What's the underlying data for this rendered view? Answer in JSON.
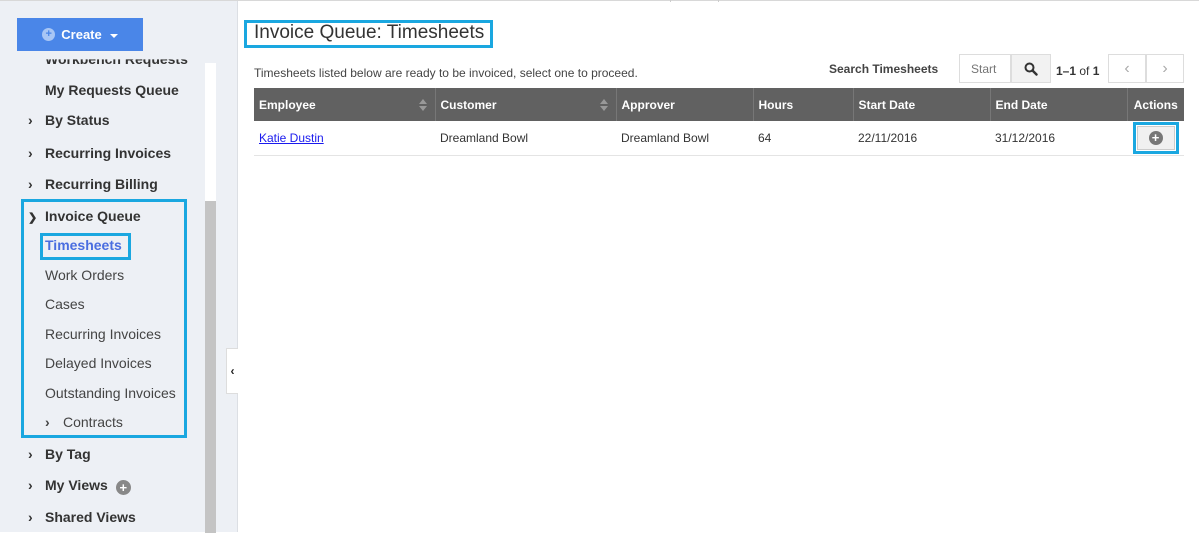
{
  "sidebar": {
    "create_label": "Create",
    "cut_item": "Workbench Requests",
    "items": [
      {
        "label": "My Requests Queue",
        "chevron": ""
      },
      {
        "label": "By Status",
        "chevron": "›"
      },
      {
        "label": "Recurring Invoices",
        "chevron": "›"
      },
      {
        "label": "Recurring Billing",
        "chevron": "›"
      },
      {
        "label": "Invoice Queue",
        "chevron": "⌄"
      }
    ],
    "invoice_queue_children": [
      {
        "label": "Timesheets",
        "active": true
      },
      {
        "label": "Work Orders"
      },
      {
        "label": "Cases"
      },
      {
        "label": "Recurring Invoices"
      },
      {
        "label": "Delayed Invoices"
      },
      {
        "label": "Outstanding Invoices"
      },
      {
        "label": "Contracts",
        "chevron": "›"
      }
    ],
    "bottom_items": [
      {
        "label": "By Tag",
        "chevron": "›"
      },
      {
        "label": "My Views",
        "chevron": "›"
      },
      {
        "label": "Shared Views",
        "chevron": "›"
      }
    ],
    "collapse_glyph": "‹"
  },
  "main": {
    "title": "Invoice Queue: Timesheets",
    "description": "Timesheets listed below are ready to be invoiced, select one to proceed.",
    "search": {
      "label": "Search Timesheets",
      "placeholder": "Start"
    },
    "pager": {
      "range": "1–1",
      "of_label": "of",
      "total": "1",
      "prev": "‹",
      "next": "›"
    },
    "table": {
      "columns": [
        "Employee",
        "Customer",
        "Approver",
        "Hours",
        "Start Date",
        "End Date",
        "Actions"
      ],
      "rows": [
        {
          "employee": "Katie Dustin",
          "customer": "Dreamland Bowl",
          "approver": "Dreamland Bowl",
          "hours": "64",
          "start_date": "22/11/2016",
          "end_date": "31/12/2016",
          "action_glyph": "+"
        }
      ]
    }
  },
  "colors": {
    "accent": "#4a86e8",
    "highlight": "#1aa7e0",
    "table_header": "#616161",
    "link": "#1a1aee"
  }
}
